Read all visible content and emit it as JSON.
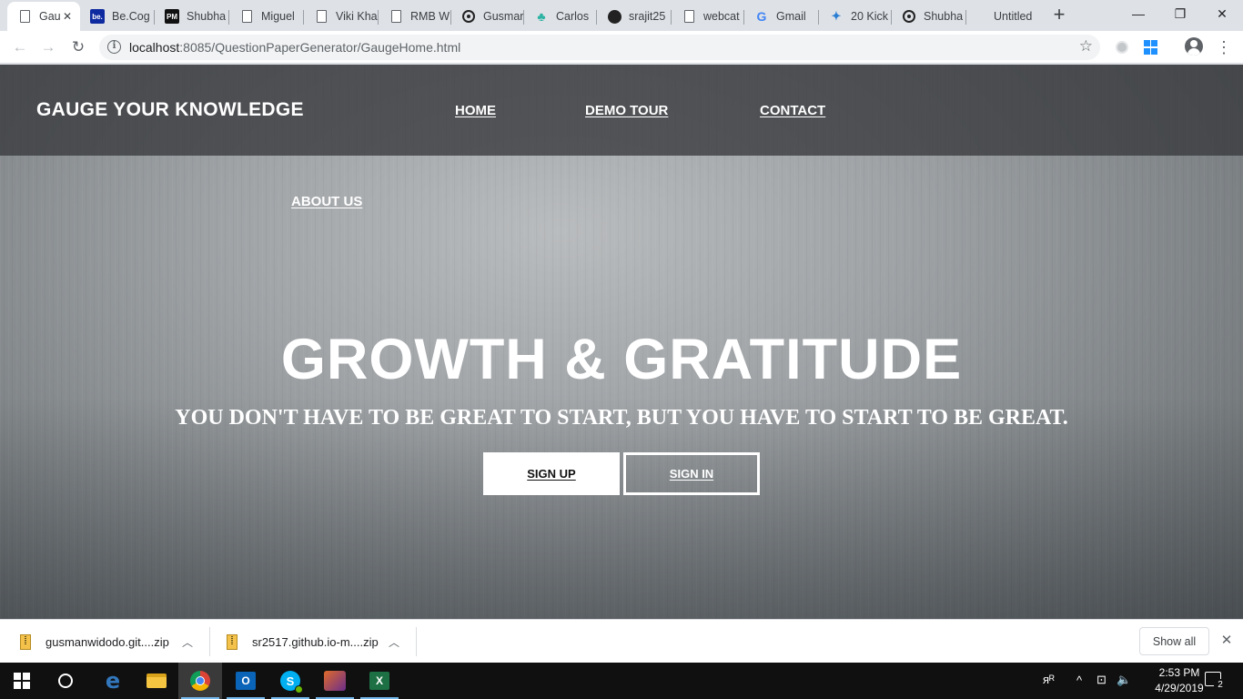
{
  "browser": {
    "tabs": [
      {
        "title": "Gau",
        "icon": "doc-icon",
        "active": true
      },
      {
        "title": "Be.Cog",
        "icon": "behance-icon"
      },
      {
        "title": "Shubha",
        "icon": "pm-icon"
      },
      {
        "title": "Miguel",
        "icon": "doc-icon"
      },
      {
        "title": "Viki Kha",
        "icon": "doc-icon"
      },
      {
        "title": "RMB W",
        "icon": "doc-icon"
      },
      {
        "title": "Gusmar",
        "icon": "ring-icon"
      },
      {
        "title": "Carlos",
        "icon": "cactus-icon"
      },
      {
        "title": "srajit25",
        "icon": "github-icon"
      },
      {
        "title": "webcat",
        "icon": "doc-icon"
      },
      {
        "title": "Gmail",
        "icon": "google-icon"
      },
      {
        "title": "20 Kick",
        "icon": "kick-icon"
      },
      {
        "title": "Shubha",
        "icon": "ring-icon"
      },
      {
        "title": "Untitled",
        "icon": "none"
      }
    ],
    "favicon_glyphs": {
      "behance": "be.",
      "pm": "PM",
      "google": "G",
      "cactus": "♣",
      "kick": "✦"
    },
    "new_tab_glyph": "+",
    "tab_close_glyph": "✕",
    "window_controls": {
      "minimize": "—",
      "maximize": "❐",
      "close": "✕"
    },
    "nav": {
      "back": "←",
      "forward": "→",
      "reload": "↻"
    },
    "url_host": "localhost",
    "url_rest": ":8085/QuestionPaperGenerator/GaugeHome.html",
    "info_glyph": "i",
    "bookmark_glyph": "☆",
    "menu_glyph": "⋮"
  },
  "site": {
    "brand": "GAUGE YOUR KNOWLEDGE",
    "nav": {
      "home": "HOME",
      "demo_tour": "DEMO TOUR",
      "contact": "CONTACT",
      "about_us": "ABOUT US"
    },
    "hero": {
      "title": "GROWTH & GRATITUDE",
      "subtitle": "YOU DON'T HAVE TO BE GREAT TO START, BUT YOU HAVE TO START TO BE GREAT.",
      "signup_label": "SIGN UP",
      "signin_label": "SIGN IN"
    },
    "colors": {
      "header_bg": "#37393c",
      "text": "#ffffff",
      "signup_bg": "#ffffff"
    }
  },
  "downloads": {
    "items": [
      {
        "name": "gusmanwidodo.git....zip"
      },
      {
        "name": "sr2517.github.io-m....zip"
      }
    ],
    "chevron_glyph": "︿",
    "show_all": "Show all",
    "close_glyph": "✕"
  },
  "taskbar": {
    "edge_glyph": "e",
    "outlook_glyph": "O",
    "skype_glyph": "S",
    "excel_glyph": "X",
    "tray": {
      "people": "ᴙᴿ",
      "chevron": "^",
      "network": "⊡",
      "volume": "🔈"
    },
    "time": "2:53 PM",
    "date": "4/29/2019",
    "notification_count": "2"
  }
}
